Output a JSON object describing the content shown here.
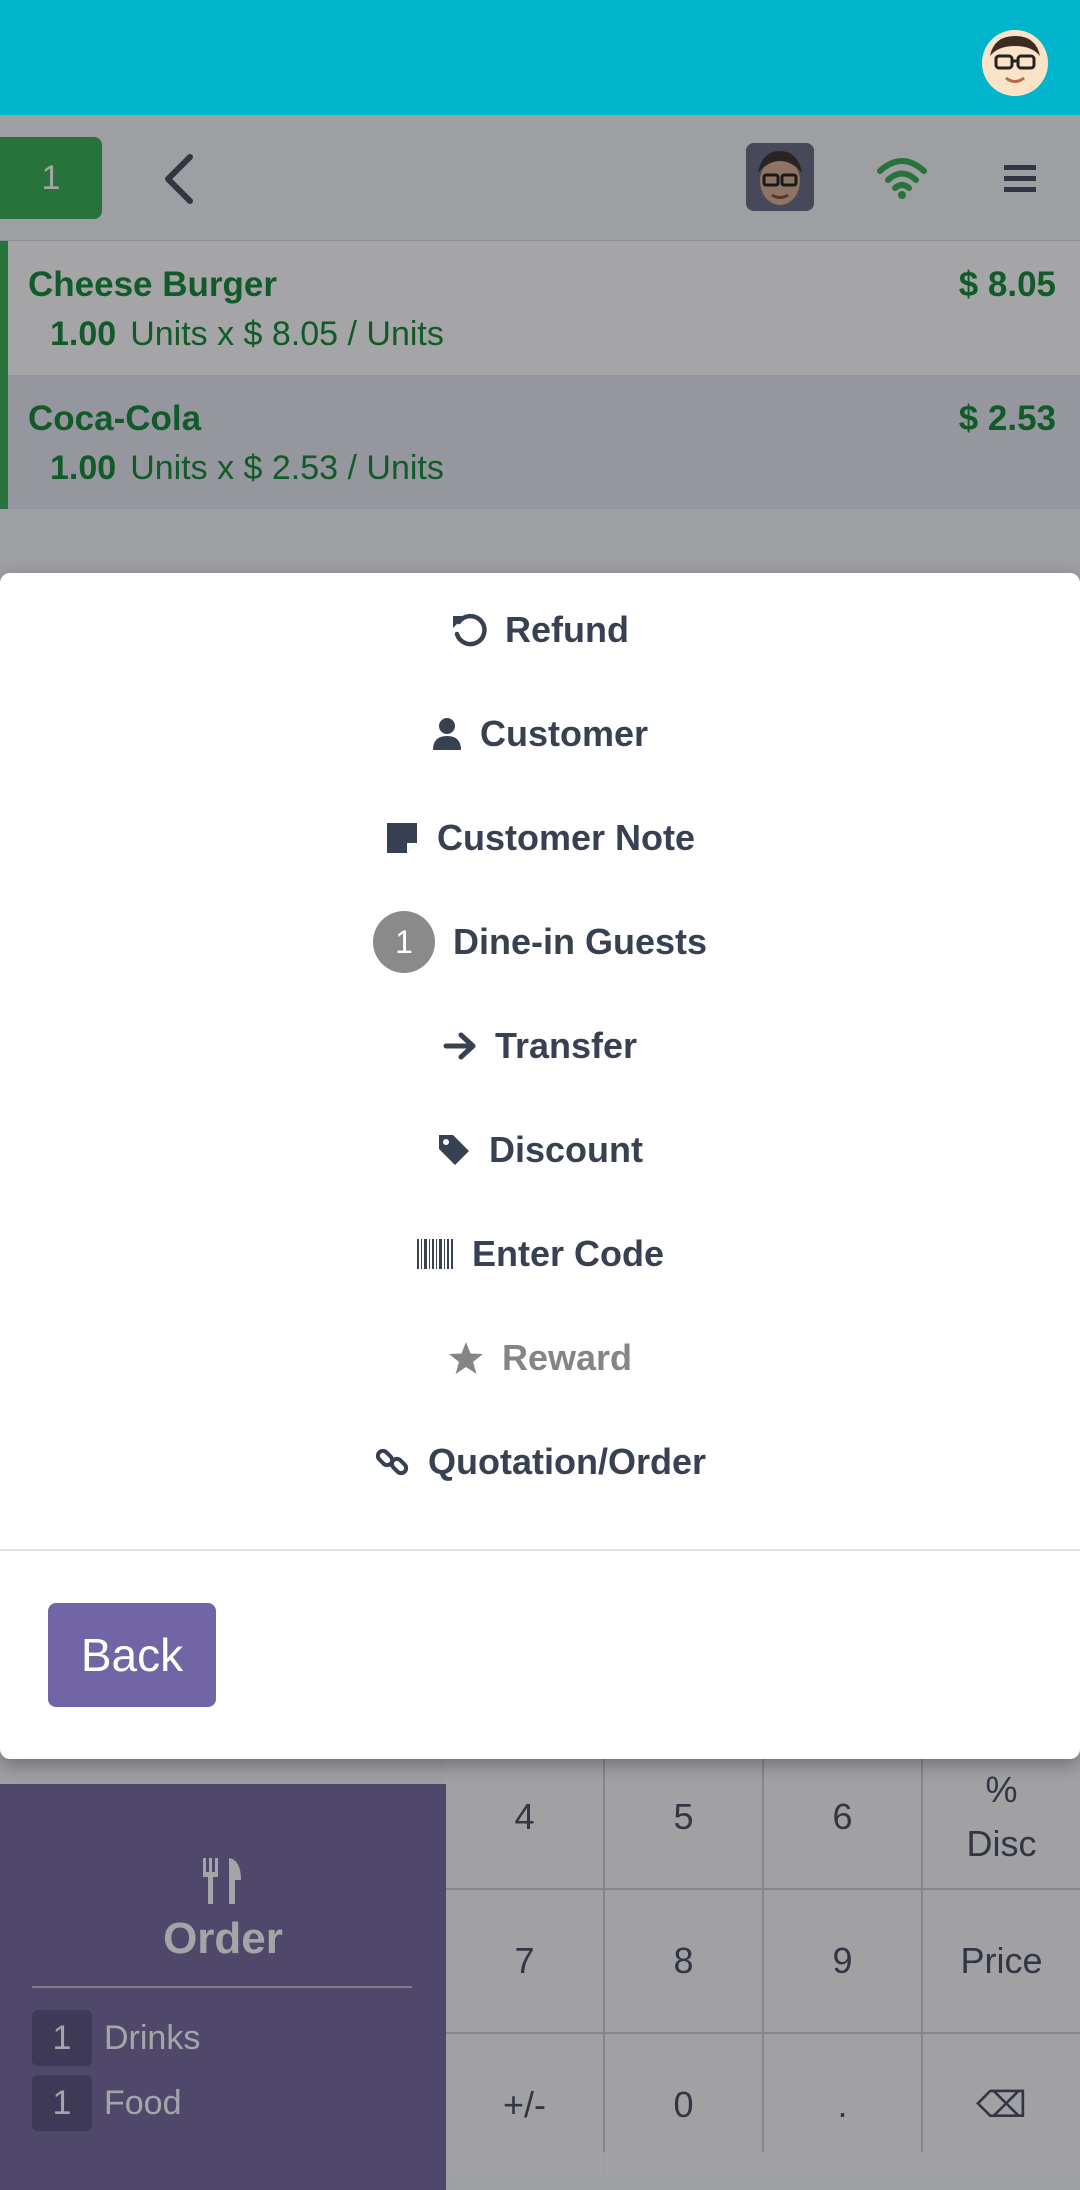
{
  "header": {
    "order_number": "1"
  },
  "orderlines": [
    {
      "name": "Cheese Burger",
      "price": "$ 8.05",
      "qty": "1.00",
      "unit_detail": "Units x $ 8.05 / Units"
    },
    {
      "name": "Coca-Cola",
      "price": "$ 2.53",
      "qty": "1.00",
      "unit_detail": "Units x $ 2.53 / Units"
    }
  ],
  "modal": {
    "items": [
      {
        "label": "Refund",
        "icon": "refund-icon"
      },
      {
        "label": "Customer",
        "icon": "user-icon"
      },
      {
        "label": "Customer Note",
        "icon": "note-icon"
      },
      {
        "label": "Dine-in Guests",
        "icon": "guest-count-badge",
        "badge": "1"
      },
      {
        "label": "Transfer",
        "icon": "arrow-right-icon"
      },
      {
        "label": "Discount",
        "icon": "tag-icon"
      },
      {
        "label": "Enter Code",
        "icon": "barcode-icon"
      },
      {
        "label": "Reward",
        "icon": "star-icon",
        "disabled": true
      },
      {
        "label": "Quotation/Order",
        "icon": "link-icon"
      }
    ],
    "back_label": "Back"
  },
  "action_panel": {
    "order_label": "Order",
    "summary": [
      {
        "count": "1",
        "label": "Drinks"
      },
      {
        "count": "1",
        "label": "Food"
      }
    ]
  },
  "numpad": {
    "keys": [
      "4",
      "5",
      "6",
      "%\nDisc",
      "7",
      "8",
      "9",
      "Price",
      "+/-",
      "0",
      ".",
      "⌫"
    ]
  },
  "colors": {
    "topbar": "#00b5cc",
    "accent_green": "#28a745",
    "text_green": "#017e26",
    "purple": "#7165a6"
  }
}
